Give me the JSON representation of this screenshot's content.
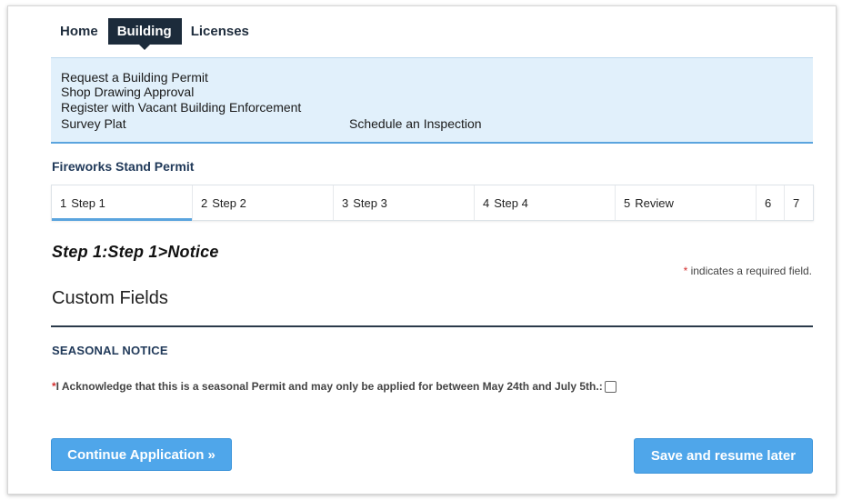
{
  "topnav": {
    "home": "Home",
    "building": "Building",
    "licenses": "Licenses"
  },
  "submenu": {
    "request_permit": "Request a Building Permit",
    "shop_drawing": "Shop Drawing Approval",
    "vacant_building": "Register with Vacant Building Enforcement",
    "survey_plat": "Survey Plat",
    "schedule_inspection": "Schedule an Inspection"
  },
  "page_title": "Fireworks Stand Permit",
  "steps": [
    {
      "num": "1",
      "label": "Step 1"
    },
    {
      "num": "2",
      "label": "Step 2"
    },
    {
      "num": "3",
      "label": "Step 3"
    },
    {
      "num": "4",
      "label": "Step 4"
    },
    {
      "num": "5",
      "label": "Review"
    },
    {
      "num": "6",
      "label": ""
    },
    {
      "num": "7",
      "label": ""
    }
  ],
  "step_heading": "Step 1:Step 1>Notice",
  "required_note": {
    "star": "*",
    "text": "indicates a required field."
  },
  "custom_fields_title": "Custom Fields",
  "section_title": "SEASONAL NOTICE",
  "acknowledge": {
    "star": "*",
    "text": "I Acknowledge that this is a seasonal Permit and may only be applied for between May 24th and July 5th.:"
  },
  "buttons": {
    "continue": "Continue Application »",
    "save_resume": "Save and resume later"
  }
}
